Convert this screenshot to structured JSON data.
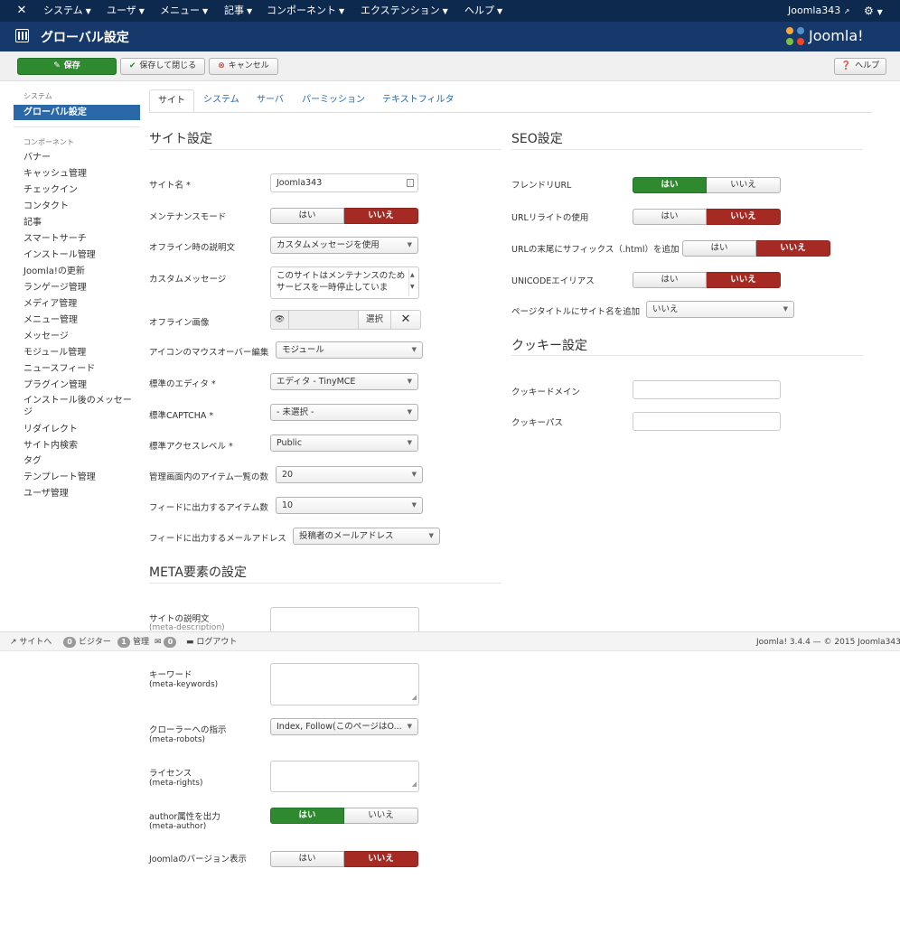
{
  "topnav": {
    "menus": [
      "システム",
      "ユーザ",
      "メニュー",
      "記事",
      "コンポーネント",
      "エクステンション",
      "ヘルプ"
    ],
    "user": "Joomla343"
  },
  "header": {
    "title": "グローバル設定",
    "brand": "Joomla!"
  },
  "toolbar": {
    "save": "保存",
    "save_close": "保存して閉じる",
    "cancel": "キャンセル",
    "help": "ヘルプ"
  },
  "sidebar": {
    "system_heading": "システム",
    "active_item": "グローバル設定",
    "component_heading": "コンポーネント",
    "items": [
      "バナー",
      "キャッシュ管理",
      "チェックイン",
      "コンタクト",
      "記事",
      "スマートサーチ",
      "インストール管理",
      "Joomla!の更新",
      "ランゲージ管理",
      "メディア管理",
      "メニュー管理",
      "メッセージ",
      "モジュール管理",
      "ニュースフィード",
      "プラグイン管理",
      "インストール後のメッセージ",
      "リダイレクト",
      "サイト内検索",
      "タグ",
      "テンプレート管理",
      "ユーザ管理"
    ]
  },
  "tabs": [
    "サイト",
    "システム",
    "サーバ",
    "パーミッション",
    "テキストフィルタ"
  ],
  "toggle": {
    "yes": "はい",
    "no": "いいえ"
  },
  "site": {
    "heading": "サイト設定",
    "site_name_label": "サイト名 *",
    "site_name_value": "Joomla343",
    "maintenance_label": "メンテナンスモード",
    "maintenance_value": "no",
    "offline_msg_label": "オフライン時の説明文",
    "offline_msg_value": "カスタムメッセージを使用",
    "custom_msg_label": "カスタムメッセージ",
    "custom_msg_value": "このサイトはメンテナンスのためサービスを一時停止していま",
    "offline_image_label": "オフライン画像",
    "offline_image_select": "選択",
    "icon_hover_label": "アイコンのマウスオーバー編集",
    "icon_hover_value": "モジュール",
    "editor_label": "標準のエディタ *",
    "editor_value": "エディタ - TinyMCE",
    "captcha_label": "標準CAPTCHA *",
    "captcha_value": "- 未選択 -",
    "access_label": "標準アクセスレベル *",
    "access_value": "Public",
    "list_limit_label": "管理画面内のアイテム一覧の数",
    "list_limit_value": "20",
    "feed_limit_label": "フィードに出力するアイテム数",
    "feed_limit_value": "10",
    "feed_email_label": "フィードに出力するメールアドレス",
    "feed_email_value": "投稿者のメールアドレス"
  },
  "meta": {
    "heading": "META要素の設定",
    "desc_label": "サイトの説明文",
    "desc_sub": "(meta-description)",
    "keywords_label": "キーワード",
    "keywords_sub": "(meta-keywords)",
    "robots_label": "クローラーへの指示",
    "robots_sub": "(meta-robots)",
    "robots_value": "Index, Follow(このページはO...",
    "rights_label": "ライセンス",
    "rights_sub": "(meta-rights)",
    "author_label": "author属性を出力",
    "author_sub": "(meta-author)",
    "author_value": "yes",
    "version_label": "Joomlaのバージョン表示",
    "version_value": "no"
  },
  "seo": {
    "heading": "SEO設定",
    "friendly_label": "フレンドリURL",
    "friendly_value": "yes",
    "rewrite_label": "URLリライトの使用",
    "rewrite_value": "no",
    "suffix_label": "URLの末尾にサフィックス（.html）を追加",
    "suffix_value": "no",
    "unicode_label": "UNICODEエイリアス",
    "unicode_value": "no",
    "pagetitle_label": "ページタイトルにサイト名を追加",
    "pagetitle_value": "いいえ"
  },
  "cookie": {
    "heading": "クッキー設定",
    "domain_label": "クッキードメイン",
    "path_label": "クッキーパス"
  },
  "statusbar": {
    "view_site": "サイトへ",
    "visitors_count": "0",
    "visitors_label": "ビジター",
    "admins_count": "1",
    "admins_label": "管理",
    "messages_count": "0",
    "logout": "ログアウト",
    "copyright": "Joomla! 3.4.4 — © 2015 Joomla343"
  },
  "colors": {
    "navbar": "#0d2a4e",
    "header": "#17386a",
    "active_blue": "#2a68a8",
    "yes_green": "#2f8a2f",
    "no_red": "#a52a23"
  }
}
